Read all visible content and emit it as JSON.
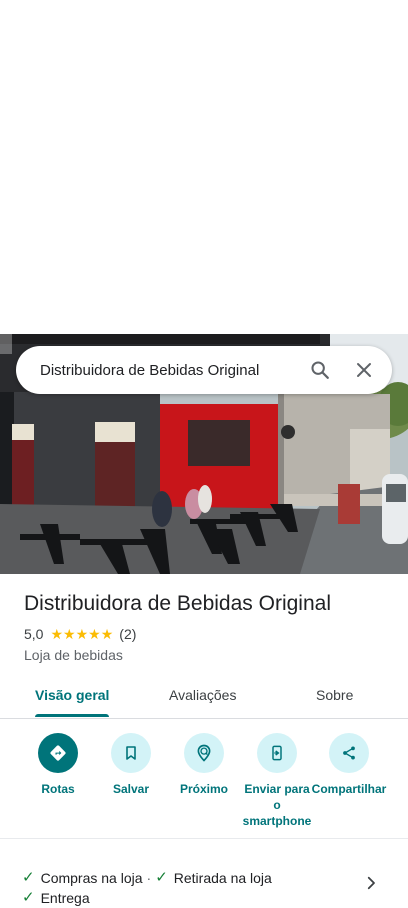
{
  "search": {
    "query": "Distribuidora de Bebidas Original"
  },
  "place": {
    "title": "Distribuidora de Bebidas Original",
    "rating": "5,0",
    "stars": 5,
    "review_count": "(2)",
    "category": "Loja de bebidas"
  },
  "tabs": [
    {
      "label": "Visão geral",
      "active": true
    },
    {
      "label": "Avaliações",
      "active": false
    },
    {
      "label": "Sobre",
      "active": false
    }
  ],
  "actions": [
    {
      "label": "Rotas",
      "icon": "directions-icon"
    },
    {
      "label": "Salvar",
      "icon": "bookmark-icon"
    },
    {
      "label": "Próximo",
      "icon": "nearby-icon"
    },
    {
      "label": "Enviar para o smartphone",
      "icon": "send-to-phone-icon"
    },
    {
      "label": "Compartilhar",
      "icon": "share-icon"
    }
  ],
  "amenities": {
    "items": [
      "Compras na loja",
      "Retirada na loja",
      "Entrega"
    ],
    "separator": "·"
  },
  "colors": {
    "accent": "#00747a",
    "accent_light": "#d3f3f7",
    "star": "#fbbc04",
    "check": "#188038"
  }
}
